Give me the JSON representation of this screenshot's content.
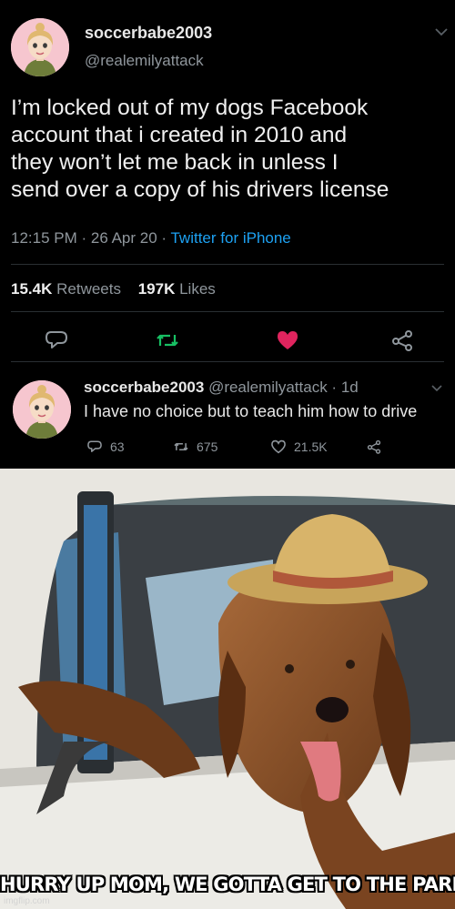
{
  "tweet": {
    "display_name": "soccerbabe2003",
    "handle": "@realemilyattack",
    "text_lines": [
      "I’m locked out of my dogs Facebook",
      "account that i created in 2010 and",
      "they won’t let me back in unless I",
      "send over a copy of his drivers license"
    ],
    "time": "12:15 PM",
    "date": "26 Apr 20",
    "source": "Twitter for iPhone",
    "retweets_count": "15.4K",
    "retweets_label": "Retweets",
    "likes_count": "197K",
    "likes_label": "Likes"
  },
  "reply": {
    "display_name": "soccerbabe2003",
    "handle": "@realemilyattack",
    "age": "1d",
    "text": "I have no choice but to teach him how to drive",
    "reply_count": "63",
    "retweet_count": "675",
    "like_count": "21.5K"
  },
  "meme": {
    "caption": "HURRY UP MOM, WE GOTTA GET TO THE PARK",
    "watermark": "imgflip.com"
  },
  "icons": {
    "reply": "comment-icon",
    "retweet": "retweet-icon",
    "like": "heart-icon",
    "share": "share-icon",
    "menu": "chevron-down-icon"
  },
  "colors": {
    "background": "#000000",
    "link": "#1da1f2",
    "retweet_green": "#17bf63",
    "like_red": "#e0245e",
    "muted": "#8f969c"
  }
}
